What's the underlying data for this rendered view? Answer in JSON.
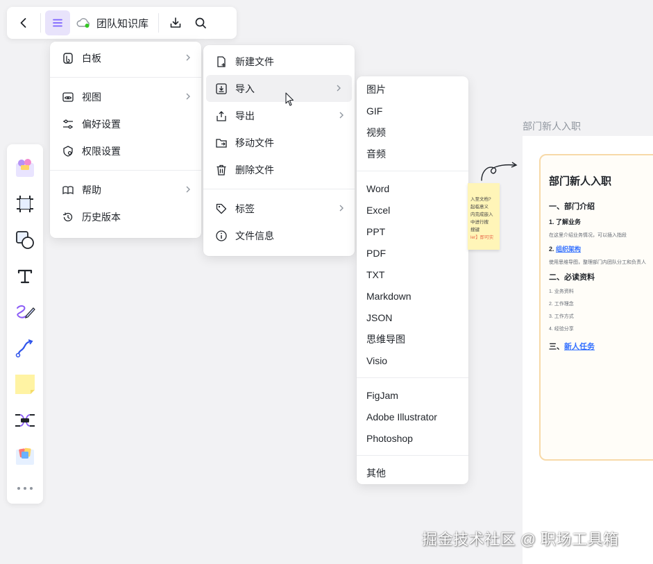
{
  "topbar": {
    "title": "团队知识库"
  },
  "main_menu": {
    "group1": [
      {
        "label": "白板",
        "icon": "whiteboard-icon",
        "submenu": true
      }
    ],
    "group2": [
      {
        "label": "视图",
        "icon": "eye-icon",
        "submenu": true
      },
      {
        "label": "偏好设置",
        "icon": "sliders-icon",
        "submenu": false
      },
      {
        "label": "权限设置",
        "icon": "permission-icon",
        "submenu": false
      }
    ],
    "group3": [
      {
        "label": "帮助",
        "icon": "book-icon",
        "submenu": true
      },
      {
        "label": "历史版本",
        "icon": "history-icon",
        "submenu": false
      }
    ]
  },
  "file_menu": {
    "items": [
      {
        "label": "新建文件",
        "icon": "new-file-icon"
      },
      {
        "label": "导入",
        "icon": "import-icon"
      },
      {
        "label": "导出",
        "icon": "export-icon"
      },
      {
        "label": "移动文件",
        "icon": "move-folder-icon"
      },
      {
        "label": "删除文件",
        "icon": "trash-icon"
      },
      {
        "label": "标签",
        "icon": "tag-icon"
      },
      {
        "label": "文件信息",
        "icon": "info-icon"
      }
    ]
  },
  "import_menu": {
    "media": [
      "图片",
      "GIF",
      "视频",
      "音频"
    ],
    "formats": [
      "Word",
      "Excel",
      "PPT",
      "PDF",
      "TXT",
      "Markdown",
      "JSON",
      "思维导图",
      "Visio"
    ],
    "apps": [
      "FigJam",
      "Adobe Illustrator",
      "Photoshop"
    ],
    "other": [
      "其他"
    ]
  },
  "canvas": {
    "doc_label": "部门新人入职",
    "doc": {
      "title": "部门新人入职",
      "s1": "一、部门介绍",
      "s1_1": "1. 了解业务",
      "s1_1_p": "在这里介绍业务情况，可以插入指段",
      "s1_2_prefix": "2. ",
      "s1_2_link": "组织架构",
      "s1_2_p": "使用思维导图，整理部门内团队分工和负责人",
      "s2": "二、必读资料",
      "s2_items": [
        "1. 业务资料",
        "2. 工作理念",
        "3. 工作方式",
        "4. 经验分享"
      ],
      "s3_prefix": "三、",
      "s3_link": "新人任务"
    },
    "sticky_lines": [
      "入至文档?",
      "起临意义",
      "内完成嵌入",
      "中进行搜",
      "搜键",
      "ler】即可实"
    ]
  },
  "watermark": "掘金技术社区 @ 职场工具箱",
  "colors": {
    "accent": "#7b61ff",
    "link": "#3370ff",
    "doc_border": "#f7d9a8",
    "sticky": "#fff5b8"
  }
}
